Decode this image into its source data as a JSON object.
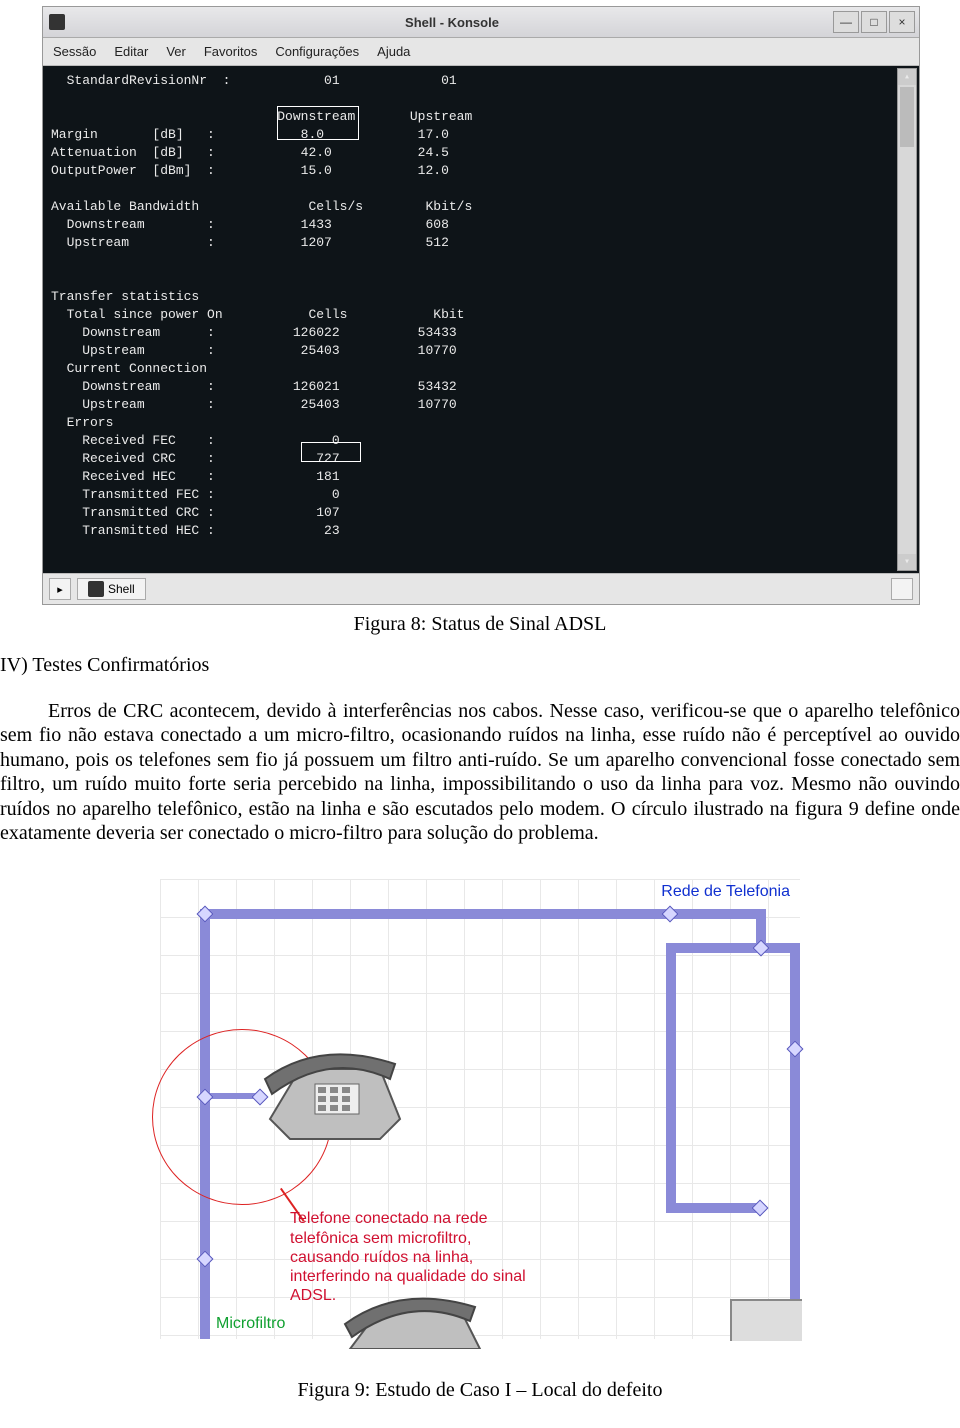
{
  "konsole": {
    "title": "Shell - Konsole",
    "menu": [
      "Sessão",
      "Editar",
      "Ver",
      "Favoritos",
      "Configurações",
      "Ajuda"
    ],
    "shell_tab": "Shell",
    "terminal_lines": [
      "  StandardRevisionNr  :            01             01",
      "",
      "                             Downstream       Upstream",
      "Margin       [dB]   :           8.0            17.0",
      "Attenuation  [dB]   :           42.0           24.5",
      "OutputPower  [dBm]  :           15.0           12.0",
      "",
      "Available Bandwidth              Cells/s        Kbit/s",
      "  Downstream        :           1433            608",
      "  Upstream          :           1207            512",
      "",
      "",
      "Transfer statistics",
      "  Total since power On           Cells           Kbit",
      "    Downstream      :          126022          53433",
      "    Upstream        :           25403          10770",
      "  Current Connection",
      "    Downstream      :          126021          53432",
      "    Upstream        :           25403          10770",
      "  Errors",
      "    Received FEC    :               0",
      "    Received CRC    :             727",
      "    Received HEC    :             181",
      "    Transmitted FEC :               0",
      "    Transmitted CRC :             107",
      "    Transmitted HEC :              23"
    ]
  },
  "caption1": "Figura 8: Status de Sinal ADSL",
  "section_heading": "IV) Testes Confirmatórios",
  "paragraph": "Erros de CRC acontecem, devido à interferências nos cabos. Nesse caso, verificou-se que o aparelho telefônico sem fio não estava conectado a um micro-filtro, ocasionando ruídos na linha, esse ruído não é perceptível ao ouvido humano, pois os telefones sem fio já possuem um filtro anti-ruído. Se um aparelho convencional fosse conectado sem filtro, um ruído muito forte seria percebido na linha, impossibilitando o uso da linha para voz. Mesmo não ouvindo ruídos no aparelho telefônico, estão na linha e são escutados pelo modem. O círculo ilustrado na figura 9 define onde exatamente deveria ser conectado o micro-filtro para solução do problema.",
  "diagram": {
    "rede_label": "Rede de Telefonia",
    "warning_lines": [
      "Telefone conectado na rede",
      "telefônica sem microfiltro,",
      "causando ruídos na linha,",
      "interferindo na qualidade do sinal",
      "ADSL."
    ],
    "microfiltro_label": "Microfiltro"
  },
  "caption2": "Figura 9: Estudo de Caso I – Local do defeito"
}
